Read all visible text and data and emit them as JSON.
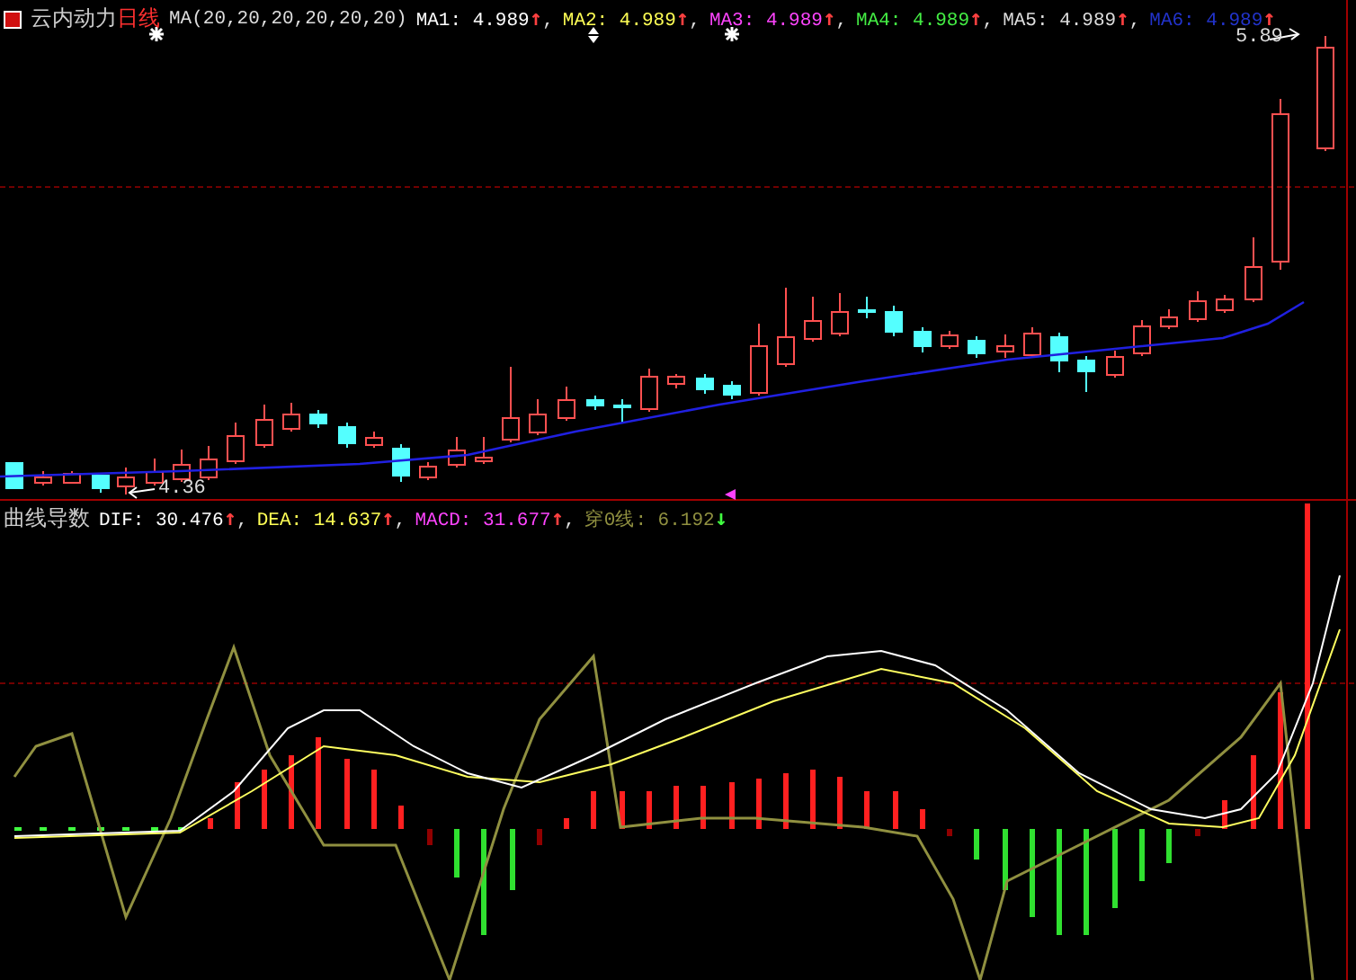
{
  "price_panel": {
    "title": "云内动力",
    "period": "日线",
    "indicator": "MA(20,20,20,20,20,20)",
    "legend": [
      {
        "label": "MA1:",
        "value": "4.989",
        "arrow": {
          "text": "↑",
          "color": "#ff4040"
        },
        "color": "#ffffff",
        "sep": ","
      },
      {
        "label": "MA2:",
        "value": "4.989",
        "arrow": {
          "text": "↑",
          "color": "#ff4040"
        },
        "color": "#ffff55",
        "sep": ","
      },
      {
        "label": "MA3:",
        "value": "4.989",
        "arrow": {
          "text": "↑",
          "color": "#ff4040"
        },
        "color": "#ff44ff",
        "sep": ","
      },
      {
        "label": "MA4:",
        "value": "4.989",
        "arrow": {
          "text": "↑",
          "color": "#ff4040"
        },
        "color": "#44ee44",
        "sep": ","
      },
      {
        "label": "MA5:",
        "value": "4.989",
        "arrow": {
          "text": "↑",
          "color": "#ff4040"
        },
        "color": "#dddddd",
        "sep": ","
      },
      {
        "label": "MA6:",
        "value": "4.989",
        "arrow": {
          "text": "↑",
          "color": "#ff4040"
        },
        "color": "#2233cc"
      }
    ],
    "high_label": "5.89",
    "low_label": "4.36"
  },
  "indicator_panel": {
    "title": "曲线导数",
    "legend": [
      {
        "label": "DIF:",
        "value": "30.476",
        "arrow": {
          "text": "↑",
          "color": "#ff4040"
        },
        "color": "#ffffff",
        "sep": ","
      },
      {
        "label": "DEA:",
        "value": "14.637",
        "arrow": {
          "text": "↑",
          "color": "#ff4040"
        },
        "color": "#ffff55",
        "sep": ","
      },
      {
        "label": "MACD:",
        "value": "31.677",
        "arrow": {
          "text": "↑",
          "color": "#ff4040"
        },
        "color": "#ff44ff",
        "sep": ","
      },
      {
        "label": "穿0线:",
        "value": "6.192",
        "arrow": {
          "text": "↓",
          "color": "#40ff40"
        },
        "color": "#909040"
      }
    ]
  }
}
